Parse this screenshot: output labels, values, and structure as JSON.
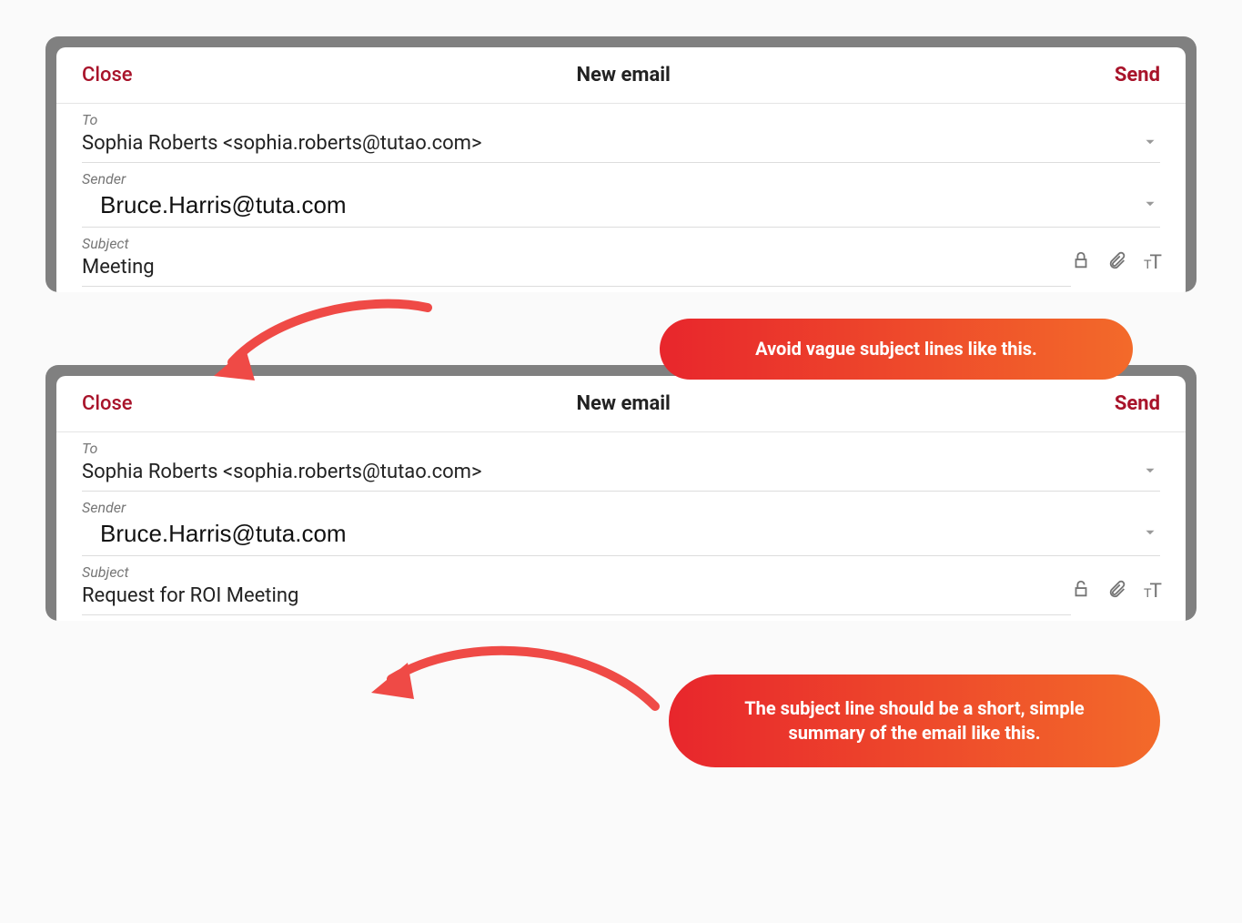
{
  "panel1": {
    "close": "Close",
    "title": "New email",
    "send": "Send",
    "to_label": "To",
    "to_value": "Sophia Roberts <sophia.roberts@tutao.com>",
    "sender_label": "Sender",
    "sender_value": "Bruce.Harris@tuta.com",
    "subject_label": "Subject",
    "subject_value": "Meeting",
    "callout": "Avoid vague subject lines like this."
  },
  "panel2": {
    "close": "Close",
    "title": "New email",
    "send": "Send",
    "to_label": "To",
    "to_value": "Sophia Roberts <sophia.roberts@tutao.com>",
    "sender_label": "Sender",
    "sender_value": "Bruce.Harris@tuta.com",
    "subject_label": "Subject",
    "subject_value": "Request for ROI Meeting",
    "callout": "The subject line should be a short, simple summary of the email like this."
  }
}
